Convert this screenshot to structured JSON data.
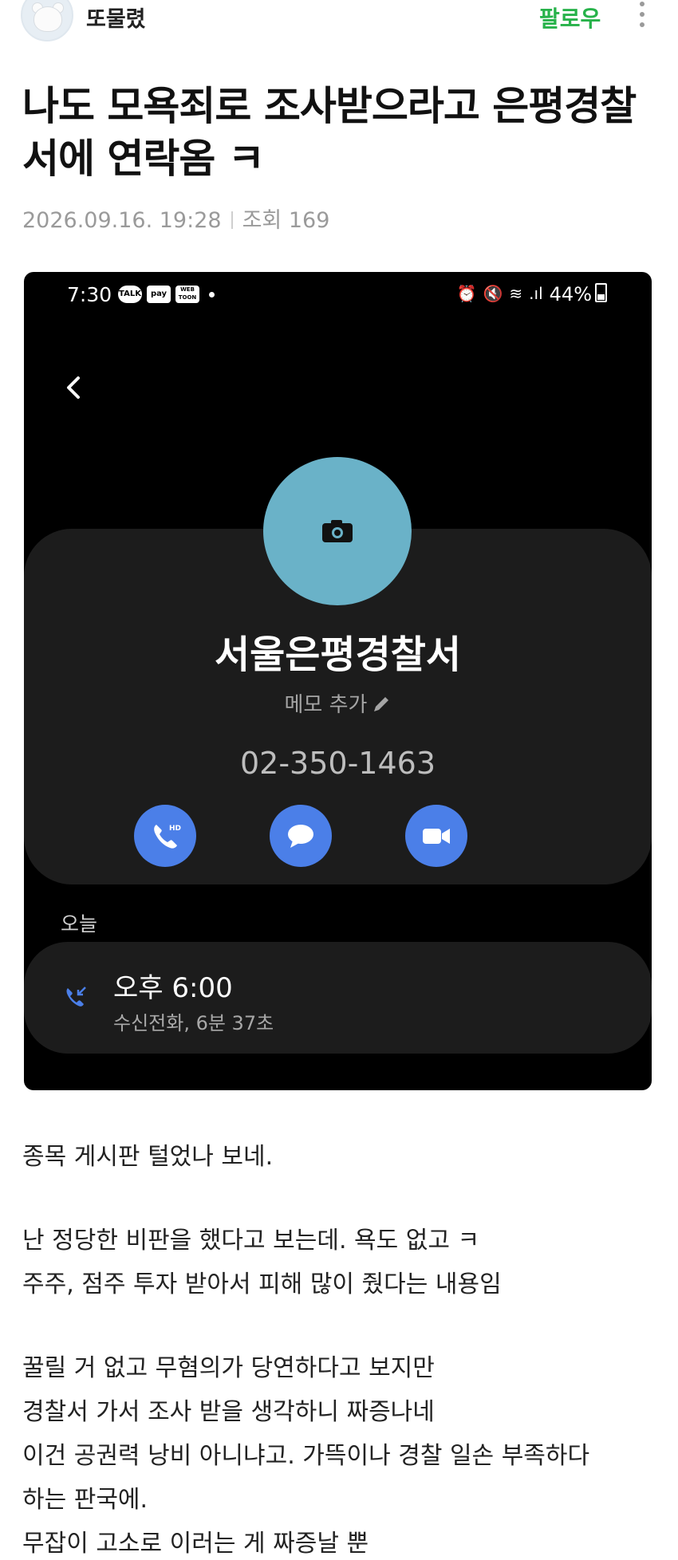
{
  "author": {
    "name": "또물렸",
    "follow_label": "팔로우"
  },
  "post": {
    "title": "나도 모욕죄로 조사받으라고 은평경찰서에 연락옴 ㅋ",
    "date": "2026.09.16. 19:28",
    "views": "조회 169"
  },
  "screenshot": {
    "status_bar": {
      "time": "7:30",
      "app_icons": [
        "TALK",
        "pay",
        "WEB TOON"
      ],
      "battery": "44%",
      "icons": [
        "alarm-icon",
        "mute-icon",
        "wifi-icon",
        "signal-icon",
        "battery-icon"
      ]
    },
    "contact": {
      "name": "서울은평경찰서",
      "memo_label": "메모 추가",
      "number": "02-350-1463",
      "photo_color": "#6ab2c8",
      "accent_color": "#4b7fe8",
      "actions": [
        {
          "icon": "hd-voice-call-icon"
        },
        {
          "icon": "message-icon"
        },
        {
          "icon": "video-call-icon"
        }
      ]
    },
    "history": {
      "section_label": "오늘",
      "calls": [
        {
          "time": "오후 6:00",
          "detail": "수신전화, 6분 37초",
          "icon": "incoming-call-icon"
        }
      ]
    }
  },
  "body": {
    "lines": [
      "종목 게시판 털었나 보네.",
      "",
      "난 정당한 비판을 했다고 보는데. 욕도 없고 ㅋ",
      "주주, 점주 투자 받아서 피해 많이 줬다는 내용임",
      "",
      "꿀릴 거 없고 무혐의가 당연하다고 보지만",
      "경찰서 가서 조사 받을 생각하니 짜증나네",
      "이건 공권력 낭비 아니냐고. 가뜩이나 경찰 일손 부족하다",
      "하는 판국에.",
      "무잡이 고소로 이러는 게 짜증날 뿐"
    ]
  }
}
